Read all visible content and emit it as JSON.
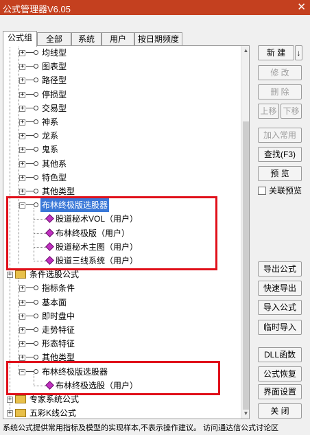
{
  "window": {
    "title": "公式管理器V6.05",
    "close_glyph": "✕"
  },
  "tabs": [
    "公式组",
    "全部",
    "系统",
    "用户",
    "按日期频度"
  ],
  "tree": {
    "items": [
      {
        "label": "均线型",
        "type": "formula-group"
      },
      {
        "label": "图表型",
        "type": "formula-group"
      },
      {
        "label": "路径型",
        "type": "formula-group"
      },
      {
        "label": "停损型",
        "type": "formula-group"
      },
      {
        "label": "交易型",
        "type": "formula-group"
      },
      {
        "label": "神系",
        "type": "formula-group"
      },
      {
        "label": "龙系",
        "type": "formula-group"
      },
      {
        "label": "鬼系",
        "type": "formula-group"
      },
      {
        "label": "其他系",
        "type": "formula-group"
      },
      {
        "label": "特色型",
        "type": "formula-group"
      },
      {
        "label": "其他类型",
        "type": "formula-group"
      },
      {
        "label": "布林终极版选股器",
        "type": "formula-group",
        "selected": true,
        "expanded": true
      },
      {
        "label": "股道秘术VOL（用户）",
        "type": "formula"
      },
      {
        "label": "布林终极版（用户）",
        "type": "formula"
      },
      {
        "label": "股道秘术主图（用户）",
        "type": "formula"
      },
      {
        "label": "股道三线系统（用户）",
        "type": "formula"
      },
      {
        "label": "条件选股公式",
        "type": "folder"
      },
      {
        "label": "指标条件",
        "type": "formula-group"
      },
      {
        "label": "基本面",
        "type": "formula-group"
      },
      {
        "label": "即时盘中",
        "type": "formula-group"
      },
      {
        "label": "走势特征",
        "type": "formula-group"
      },
      {
        "label": "形态特征",
        "type": "formula-group"
      },
      {
        "label": "其他类型",
        "type": "formula-group"
      },
      {
        "label": "布林终极版选股器",
        "type": "formula-group",
        "expanded": true
      },
      {
        "label": "布林终极选股（用户）",
        "type": "formula"
      },
      {
        "label": "专家系统公式",
        "type": "folder"
      },
      {
        "label": "五彩K线公式",
        "type": "folder"
      }
    ]
  },
  "buttons": {
    "new": "新 建",
    "new_arrow": "↓",
    "modify": "修 改",
    "delete": "删 除",
    "move_up": "上移",
    "move_down": "下移",
    "add_common": "加入常用",
    "find": "查找(F3)",
    "preview": "预 览",
    "linked_preview": "关联预览",
    "export": "导出公式",
    "quick_export": "快速导出",
    "import": "导入公式",
    "temp_import": "临时导入",
    "dll": "DLL函数",
    "restore": "公式恢复",
    "ui_settings": "界面设置",
    "close": "关 闭"
  },
  "status": "系统公式提供常用指标及模型的实现样本,不表示操作建议。  访问通达信公式讨论区"
}
